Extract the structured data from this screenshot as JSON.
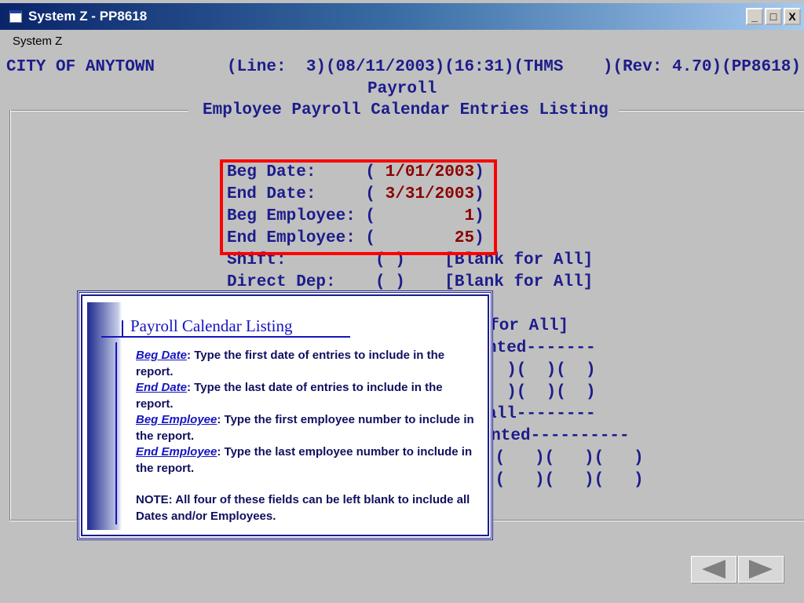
{
  "window": {
    "title": "System Z - PP8618",
    "buttons": [
      "_",
      "□",
      "X"
    ]
  },
  "menu": {
    "label": "System Z"
  },
  "header": {
    "org": "CITY OF ANYTOWN",
    "status": "(Line:  3)(08/11/2003)(16:31)(THMS    )(Rev: 4.70)(PP8618)",
    "module": "Payroll",
    "form_title": "Employee Payroll Calendar Entries Listing"
  },
  "fields": [
    {
      "label": "Beg Date:     (",
      "value": " 1/01/2003",
      "close": ")"
    },
    {
      "label": "End Date:     (",
      "value": " 3/31/2003",
      "close": ")"
    },
    {
      "label": "Beg Employee: (",
      "value": "         1",
      "close": ")"
    },
    {
      "label": "End Employee: (",
      "value": "        25",
      "close": ")"
    }
  ],
  "other_rows": [
    "Shift:         ( )    [Blank for All]",
    "Direct Dep:    ( )    [Blank for All]"
  ],
  "partial_rows": [
    "k for All]",
    "nted-------",
    "  )(  )(  )",
    "  )(  )(  )",
    "all--------",
    "rinted----------",
    ")(   )(   )(   )",
    ")(   )(   )(   )"
  ],
  "popup": {
    "title": "Payroll Calendar Listing",
    "items": [
      {
        "term": "Beg Date",
        "text": ":  Type the first date of entries to include in the report."
      },
      {
        "term": "End Date",
        "text": ":  Type the last date of entries to include in the report."
      },
      {
        "term": "Beg Employee",
        "text": ":  Type the first employee number to include in the report."
      },
      {
        "term": "End Employee",
        "text": ":  Type the last employee number to include in the report."
      }
    ],
    "note": "NOTE:  All four of these fields can be left blank to include all Dates and/or Employees."
  },
  "nav": {
    "prev": "previous",
    "next": "next"
  }
}
